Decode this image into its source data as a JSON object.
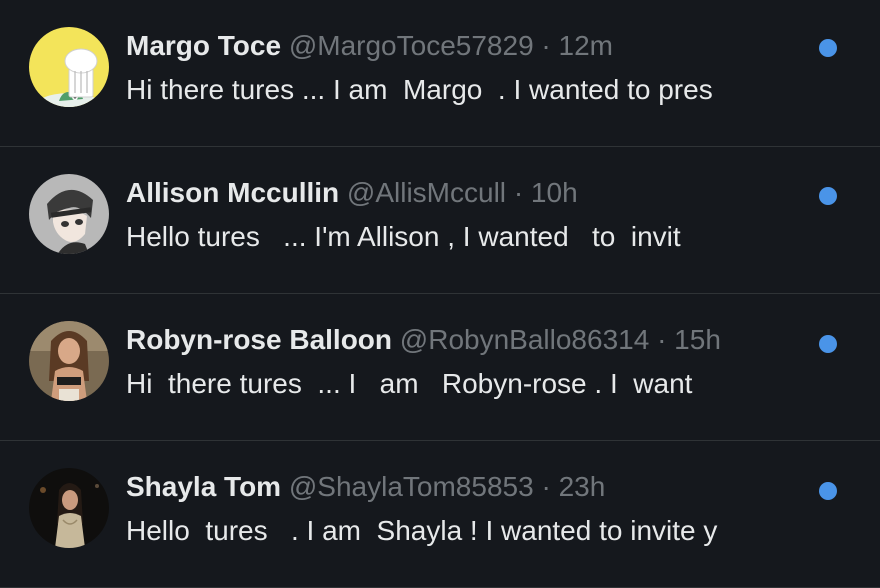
{
  "colors": {
    "background": "#15181d",
    "divider": "#2f3336",
    "primary_text": "#e7e9ea",
    "secondary_text": "#71767b",
    "unread_dot": "#4a94e8"
  },
  "conversations": [
    {
      "name": "Margo Toce",
      "handle": "@MargoToce57829",
      "separator": "·",
      "time": "12m",
      "preview": "Hi there tures ... I am  Margo  . I wanted to pres",
      "unread": true,
      "avatar_icon": "chef-hat-avatar-icon"
    },
    {
      "name": "Allison Mccullin",
      "handle": "@AllisMccull",
      "separator": "·",
      "time": "10h",
      "preview": "Hello tures   ... I'm Allison , I wanted   to  invit",
      "unread": true,
      "avatar_icon": "anime-character-avatar-icon"
    },
    {
      "name": "Robyn-rose Balloon",
      "handle": "@RobynBallo86314",
      "separator": "·",
      "time": "15h",
      "preview": "Hi  there tures  ... I   am   Robyn-rose . I  want",
      "unread": true,
      "avatar_icon": "woman-photo-avatar-icon"
    },
    {
      "name": "Shayla Tom",
      "handle": "@ShaylaTom85853",
      "separator": "·",
      "time": "23h",
      "preview": "Hello  tures   . I am  Shayla ! I wanted to invite y",
      "unread": true,
      "avatar_icon": "woman-night-photo-avatar-icon"
    }
  ]
}
